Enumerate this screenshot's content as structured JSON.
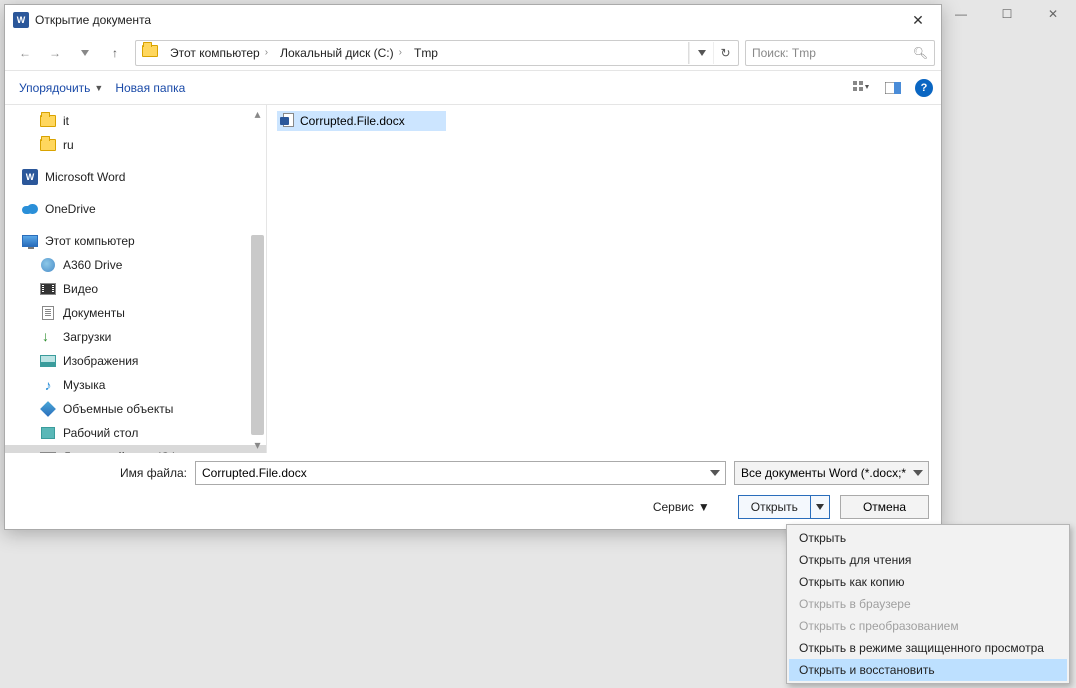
{
  "bg_controls": {
    "min": "—",
    "max": "☐",
    "close": "✕"
  },
  "dialog": {
    "title": "Открытие документа",
    "nav": {
      "crumbs": [
        "Этот компьютер",
        "Локальный диск (C:)",
        "Tmp"
      ],
      "search_placeholder": "Поиск: Tmp"
    },
    "toolbar": {
      "organize": "Упорядочить",
      "new_folder": "Новая папка",
      "help": "?"
    },
    "tree": [
      {
        "label": "it",
        "level": 2,
        "icon": "folder"
      },
      {
        "label": "ru",
        "level": 2,
        "icon": "folder"
      },
      {
        "label": "Microsoft Word",
        "level": 1,
        "icon": "word"
      },
      {
        "label": "OneDrive",
        "level": 1,
        "icon": "onedrive"
      },
      {
        "label": "Этот компьютер",
        "level": 1,
        "icon": "monitor"
      },
      {
        "label": "A360 Drive",
        "level": 2,
        "icon": "a360"
      },
      {
        "label": "Видео",
        "level": 2,
        "icon": "video"
      },
      {
        "label": "Документы",
        "level": 2,
        "icon": "doc"
      },
      {
        "label": "Загрузки",
        "level": 2,
        "icon": "download"
      },
      {
        "label": "Изображения",
        "level": 2,
        "icon": "image"
      },
      {
        "label": "Музыка",
        "level": 2,
        "icon": "music"
      },
      {
        "label": "Объемные объекты",
        "level": 2,
        "icon": "3d"
      },
      {
        "label": "Рабочий стол",
        "level": 2,
        "icon": "desktop"
      },
      {
        "label": "Локальный диск (C:)",
        "level": 2,
        "icon": "drive",
        "selected": true
      }
    ],
    "files": [
      {
        "name": "Corrupted.File.docx",
        "selected": true
      }
    ],
    "filename_label": "Имя файла:",
    "filename_value": "Corrupted.File.docx",
    "filetype": "Все документы Word (*.docx;*",
    "service": "Сервис",
    "open_btn": "Открыть",
    "cancel_btn": "Отмена"
  },
  "menu": [
    {
      "label": "Открыть"
    },
    {
      "label": "Открыть для чтения"
    },
    {
      "label": "Открыть как копию"
    },
    {
      "label": "Открыть в браузере",
      "disabled": true
    },
    {
      "label": "Открыть с преобразованием",
      "disabled": true
    },
    {
      "label": "Открыть в режиме защищенного просмотра"
    },
    {
      "label": "Открыть и восстановить",
      "highlighted": true
    }
  ]
}
